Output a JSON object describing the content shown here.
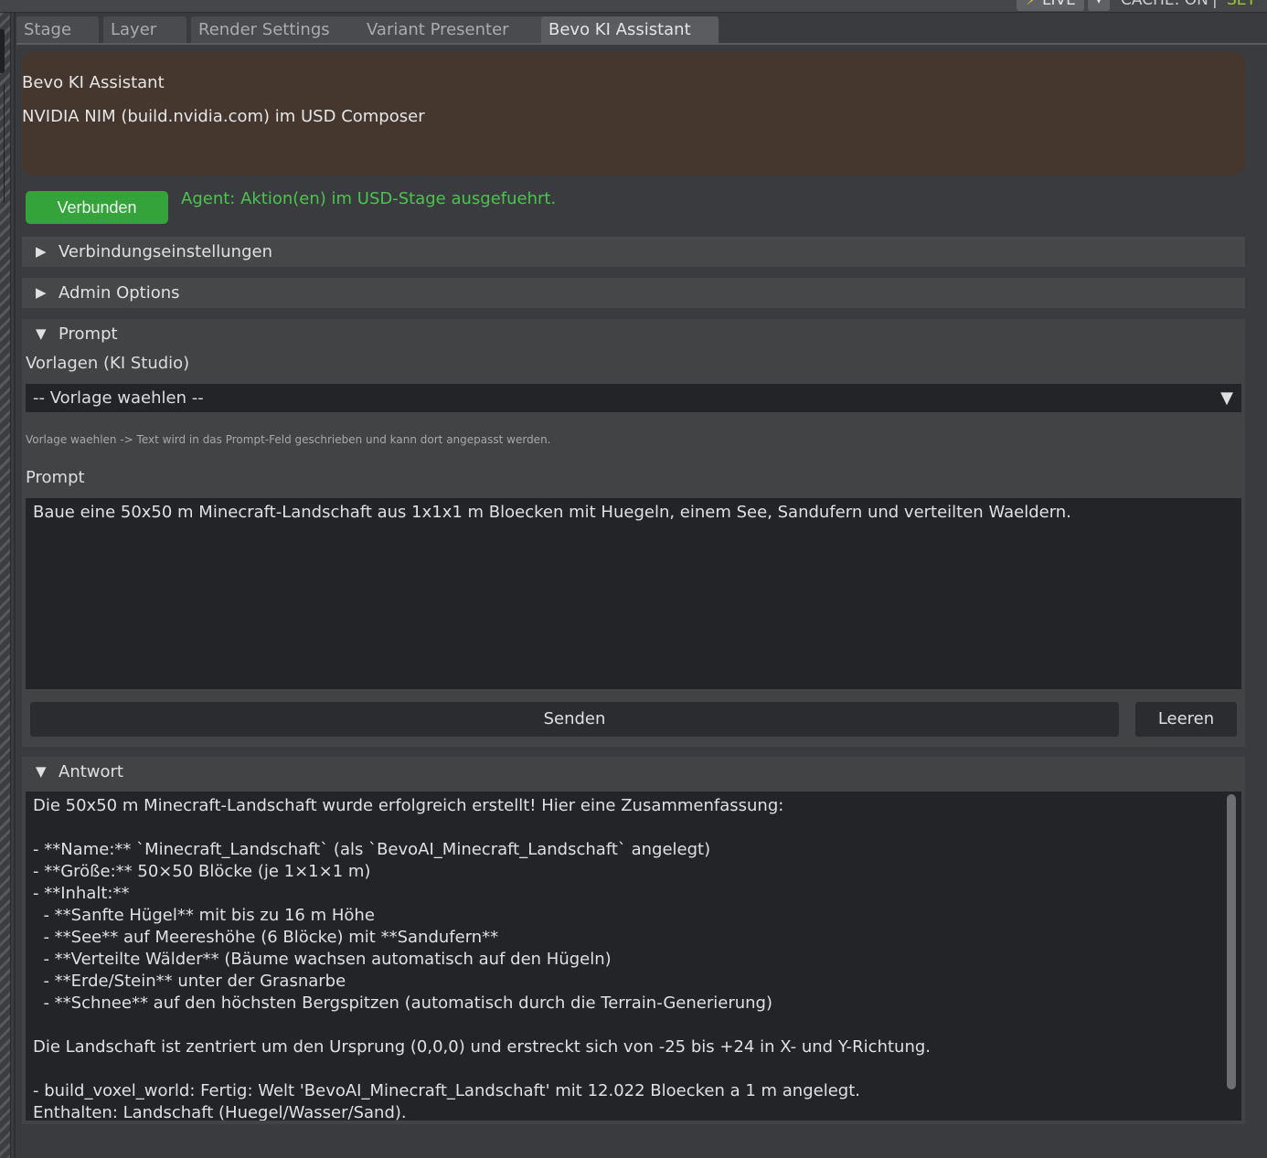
{
  "status_bar": {
    "live_label": "LIVE",
    "cache_label": "CACHE: ON",
    "separator": "|",
    "set_label": "SET"
  },
  "tabs": [
    {
      "label": "Stage"
    },
    {
      "label": "Layer"
    },
    {
      "label": "Render Settings"
    },
    {
      "label": "Variant Presenter"
    },
    {
      "label": "Bevo KI Assistant"
    }
  ],
  "info": {
    "title": "Bevo KI Assistant",
    "subtitle": "NVIDIA NIM (build.nvidia.com) im USD Composer"
  },
  "connection": {
    "button_label": "Verbunden",
    "status_text": "Agent: Aktion(en) im USD-Stage ausgefuehrt."
  },
  "sections": {
    "connection_settings": "Verbindungseinstellungen",
    "admin_options": "Admin Options",
    "prompt": "Prompt",
    "answer": "Antwort"
  },
  "prompt_section": {
    "templates_label": "Vorlagen (KI Studio)",
    "template_selected": "-- Vorlage waehlen --",
    "hint": "Vorlage waehlen -> Text wird in das Prompt-Feld geschrieben und kann dort angepasst werden.",
    "prompt_label": "Prompt",
    "prompt_text": "Baue eine 50x50 m Minecraft-Landschaft aus 1x1x1 m Bloecken mit Huegeln, einem See, Sandufern und verteilten Waeldern.",
    "send_label": "Senden",
    "clear_label": "Leeren"
  },
  "answer_lines": [
    "Die 50x50 m Minecraft-Landschaft wurde erfolgreich erstellt! Hier eine Zusammenfassung:",
    "",
    "- **Name:** `Minecraft_Landschaft` (als `BevoAI_Minecraft_Landschaft` angelegt)",
    "- **Größe:** 50×50 Blöcke (je 1×1×1 m)",
    "- **Inhalt:**",
    "  - **Sanfte Hügel** mit bis zu 16 m Höhe",
    "  - **See** auf Meereshöhe (6 Blöcke) mit **Sandufern**",
    "  - **Verteilte Wälder** (Bäume wachsen automatisch auf den Hügeln)",
    "  - **Erde/Stein** unter der Grasnarbe",
    "  - **Schnee** auf den höchsten Bergspitzen (automatisch durch die Terrain-Generierung)",
    "",
    "Die Landschaft ist zentriert um den Ursprung (0,0,0) und erstreckt sich von -25 bis +24 in X- und Y-Richtung.",
    "",
    "- build_voxel_world: Fertig: Welt 'BevoAI_Minecraft_Landschaft' mit 12.022 Bloecken a 1 m angelegt.",
    "Enthalten: Landschaft (Huegel/Wasser/Sand)."
  ]
}
